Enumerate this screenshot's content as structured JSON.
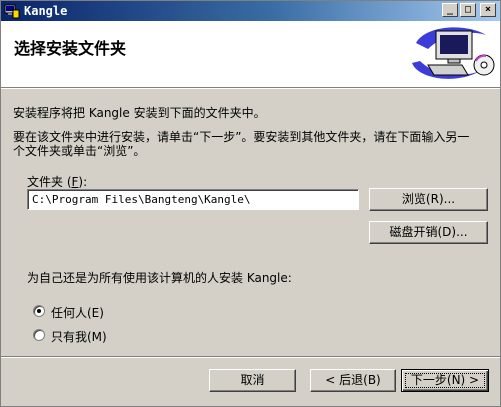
{
  "window": {
    "title": "Kangle",
    "minimize": "_",
    "maximize": "□",
    "close": "×"
  },
  "header": {
    "title": "选择安装文件夹"
  },
  "body": {
    "intro": "安装程序将把 Kangle 安装到下面的文件夹中。",
    "instruction_line1": "要在该文件夹中进行安装，请单击“下一步”。要安装到其他文件夹，请在下面输入另一",
    "instruction_line2": "个文件夹或单击“浏览”。",
    "folder_label": "文件夹 (",
    "folder_label_key": "F",
    "folder_label_end": "):",
    "folder_value": "C:\\Program Files\\Bangteng\\Kangle\\",
    "browse_button": "浏览(R)...",
    "disk_cost_button": "磁盘开销(D)...",
    "install_for_question": "为自己还是为所有使用该计算机的人安装 Kangle:",
    "radio_everyone": "任何人(E)",
    "radio_just_me": "只有我(M)",
    "selected_option": "everyone"
  },
  "footer": {
    "cancel_button": "取消",
    "back_button": "< 后退(B)",
    "next_button": "下一步(N) >"
  }
}
